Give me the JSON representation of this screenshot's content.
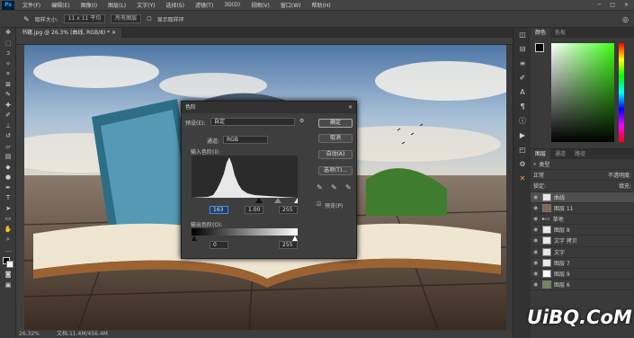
{
  "app": {
    "logo": "Ps"
  },
  "menu": [
    "文件(F)",
    "编辑(E)",
    "图像(I)",
    "图层(L)",
    "文字(Y)",
    "选择(S)",
    "滤镜(T)",
    "3D(D)",
    "视图(V)",
    "窗口(W)",
    "帮助(H)"
  ],
  "options": {
    "sample_label": "取样大小:",
    "sample_value": "11 x 11 平均",
    "sample_layers": "所有图层",
    "show_ring": "显示取样环"
  },
  "document": {
    "tab_title": "书籍.jpg @ 26.3% (曲线, RGB/8) *",
    "status": "26.32%",
    "doc_size": "文档:11.4M/456.4M"
  },
  "panels": {
    "color_tabs": [
      "颜色",
      "色板"
    ],
    "layers_tabs": [
      "图层",
      "通道",
      "路径"
    ],
    "search_placeholder": "类型",
    "mode": "正常",
    "opacity_label": "不透明度:",
    "fill_label": "填充:",
    "lock_label": "锁定:"
  },
  "layers": [
    {
      "name": "曲线",
      "selected": true
    },
    {
      "name": "图层 11",
      "selected": false
    },
    {
      "name": "草地",
      "selected": false
    },
    {
      "name": "图层 8",
      "selected": false
    },
    {
      "name": "文字 拷贝",
      "selected": false
    },
    {
      "name": "文字",
      "selected": false
    },
    {
      "name": "图层 7",
      "selected": false
    },
    {
      "name": "图层 9",
      "selected": false
    },
    {
      "name": "图层 6",
      "selected": false
    }
  ],
  "levels_dialog": {
    "title": "色阶",
    "preset_label": "预设(E):",
    "preset_value": "自定",
    "channel_label": "通道:",
    "channel_value": "RGB",
    "input_label": "输入色阶(I):",
    "input_black": "163",
    "input_mid": "1.00",
    "input_white": "255",
    "output_label": "输出色阶(O):",
    "output_black": "0",
    "output_white": "255",
    "ok": "确定",
    "cancel": "取消",
    "auto": "自动(A)",
    "options": "选项(T)...",
    "preview": "预览(P)"
  },
  "watermark": "UiBQ.CoM"
}
